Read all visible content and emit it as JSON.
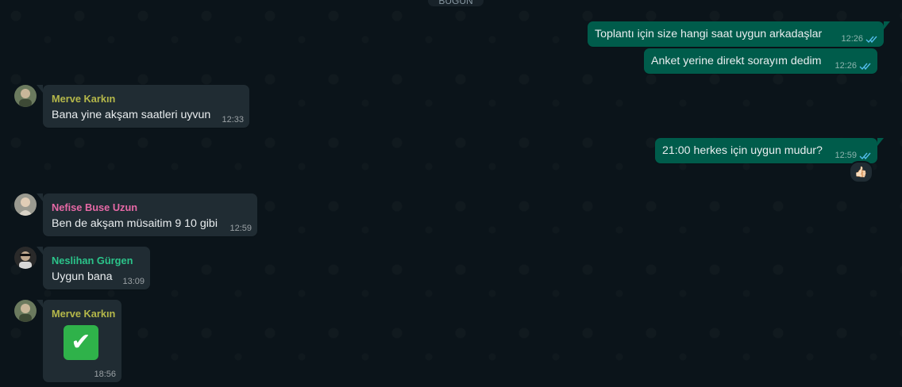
{
  "date_label": "BUGÜN",
  "colors": {
    "background": "#0b141a",
    "outgoing_bubble": "#005c4b",
    "incoming_bubble": "#202c33",
    "read_ticks": "#53bdeb",
    "merve": "#b5b84a",
    "nefise": "#e669a6",
    "neslihan": "#2bc48a"
  },
  "outgoing": [
    {
      "text": "Toplantı için size hangi saat uygun arkadaşlar",
      "time": "12:26",
      "status": "read-ticks-icon"
    },
    {
      "text": "Anket yerine direkt sorayım dedim",
      "time": "12:26",
      "status": "read-ticks-icon"
    },
    {
      "text": "21:00 herkes için uygun mudur?",
      "time": "12:59",
      "status": "read-ticks-icon",
      "reaction": "👍🏻"
    }
  ],
  "incoming": [
    {
      "sender": "Merve Karkın",
      "text": "Bana yine akşam saatleri uyvun",
      "time": "12:33"
    },
    {
      "sender": "Nefise Buse Uzun",
      "text": "Ben de akşam müsaitim 9 10 gibi",
      "time": "12:59"
    },
    {
      "sender": "Neslihan Gürgen",
      "text": "Uygun bana",
      "time": "13:09"
    },
    {
      "sender": "Merve Karkın",
      "emoji": "✔",
      "time": "18:56"
    }
  ]
}
